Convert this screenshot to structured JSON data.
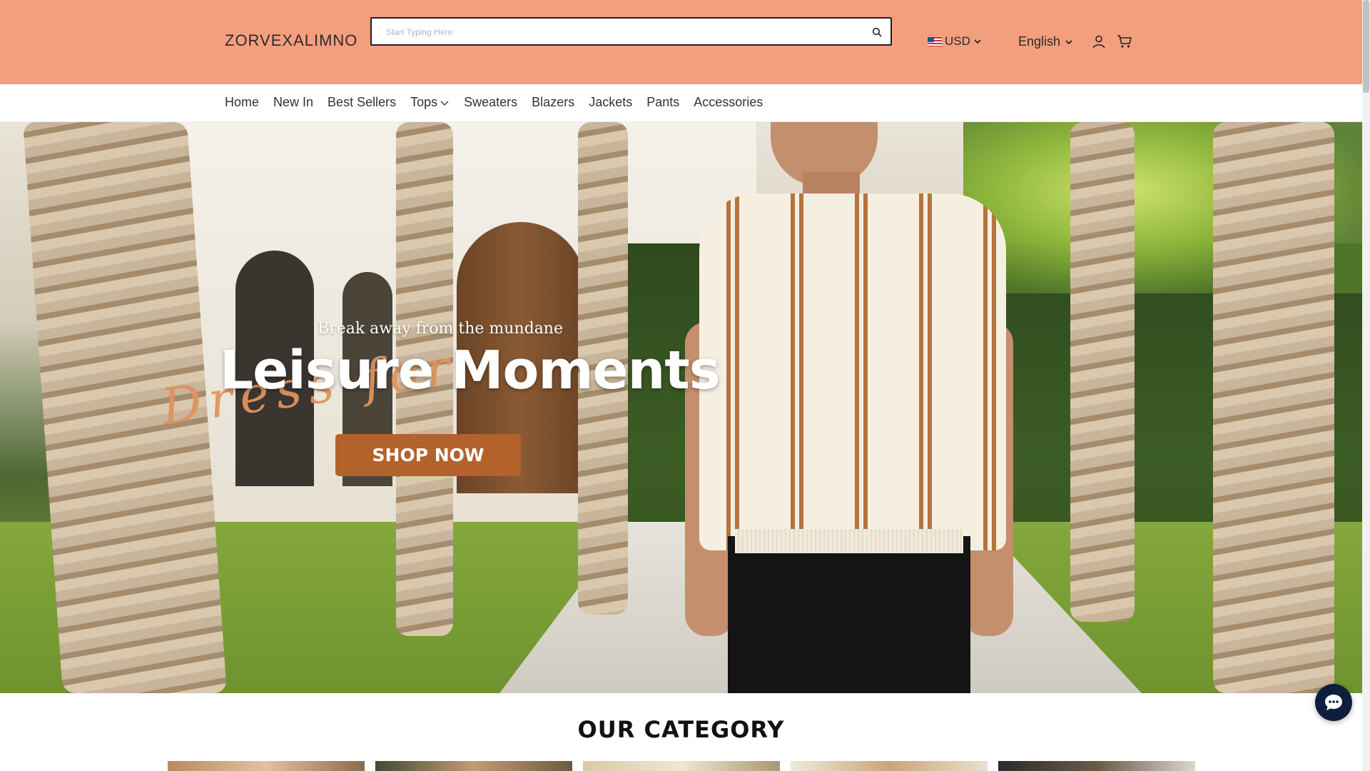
{
  "header": {
    "logo": "ZORVEXALIMNO",
    "search_placeholder": "Start Typing Here",
    "currency": "USD",
    "language": "English",
    "background_color": "#F39F7E"
  },
  "nav": {
    "items": [
      {
        "label": "Home"
      },
      {
        "label": "New In"
      },
      {
        "label": "Best Sellers"
      },
      {
        "label": "Tops",
        "has_dropdown": true
      },
      {
        "label": "Sweaters"
      },
      {
        "label": "Blazers"
      },
      {
        "label": "Jackets"
      },
      {
        "label": "Pants"
      },
      {
        "label": "Accessories"
      }
    ]
  },
  "hero": {
    "subtitle": "Break away from the mundane",
    "script_text": "Dress for",
    "title": "Leisure Moments",
    "cta_label": "SHOP NOW",
    "cta_color": "#B3622C"
  },
  "category": {
    "title": "OUR CATEGORY"
  },
  "icons": {
    "search": "search-icon",
    "user": "user-icon",
    "cart": "cart-icon",
    "chat": "chat-icon"
  }
}
